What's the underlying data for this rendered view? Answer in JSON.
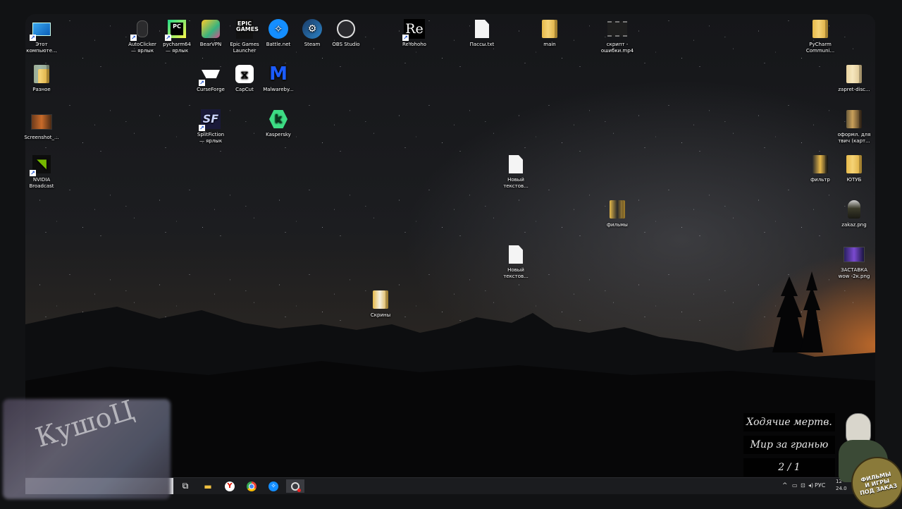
{
  "desktop_icons": [
    {
      "label": "Этот\nкомпьюте...",
      "icon": "monitor-icon"
    },
    {
      "label": "AutoClicker\n— ярлык",
      "icon": "mouse-icon"
    },
    {
      "label": "pycharm64\n— ярлык",
      "icon": "pycharm-icon"
    },
    {
      "label": "BearVPN",
      "icon": "bear-icon"
    },
    {
      "label": "Epic Games\nLauncher",
      "icon": "epic-games-icon",
      "glyph": "EPIC\nGAMES"
    },
    {
      "label": "Battle.net",
      "icon": "battlenet-icon"
    },
    {
      "label": "Steam",
      "icon": "steam-icon"
    },
    {
      "label": "OBS Studio",
      "icon": "obs-icon"
    },
    {
      "label": "ReYohoho",
      "icon": "reyohoho-icon",
      "glyph": "Re"
    },
    {
      "label": "Пассы.txt",
      "icon": "text-file-icon"
    },
    {
      "label": "main",
      "icon": "folder-icon"
    },
    {
      "label": "скрипт -\nошибки.mp4",
      "icon": "video-file-icon"
    },
    {
      "label": "PyCharm\nCommuni...",
      "icon": "folder-icon"
    },
    {
      "label": "Разное",
      "icon": "folder-icon"
    },
    {
      "label": "CurseForge",
      "icon": "curseforge-icon"
    },
    {
      "label": "CapCut",
      "icon": "capcut-icon"
    },
    {
      "label": "Malwareby...",
      "icon": "malwarebytes-icon",
      "glyph": "M"
    },
    {
      "label": "zapret-disc...",
      "icon": "folder-icon"
    },
    {
      "label": "Screenshot_...",
      "icon": "image-file-icon"
    },
    {
      "label": "SplitFiction\n— ярлык",
      "icon": "splitfiction-icon",
      "glyph": "SF"
    },
    {
      "label": "Kaspersky",
      "icon": "kaspersky-icon",
      "glyph": "k"
    },
    {
      "label": "оформл. для\nтвич (карт...",
      "icon": "folder-icon"
    },
    {
      "label": "NVIDIA\nBroadcast",
      "icon": "nvidia-icon"
    },
    {
      "label": "Новый\nтекстов...",
      "icon": "text-file-icon"
    },
    {
      "label": "фильтр",
      "icon": "folder-icon"
    },
    {
      "label": "ЮТУБ",
      "icon": "folder-icon"
    },
    {
      "label": "фильмы",
      "icon": "folder-icon"
    },
    {
      "label": "zakaz.png",
      "icon": "image-file-icon"
    },
    {
      "label": "Новый\nтекстов...",
      "icon": "text-file-icon"
    },
    {
      "label": "ЗАСТАВКА\nwow -2к.png",
      "icon": "image-file-icon"
    },
    {
      "label": "Скрины",
      "icon": "folder-icon"
    }
  ],
  "taskbar": {
    "pinned": [
      "task-view-icon",
      "file-explorer-icon",
      "yandex-browser-icon",
      "chrome-icon",
      "battlenet-icon",
      "obs-icon"
    ],
    "tray": {
      "chevron": "^",
      "language": "РУС",
      "clock_time": "12",
      "clock_date": "24.0"
    }
  },
  "overlay": {
    "streamer_name": "КушоЦ",
    "poll_option_1": "Ходячие мертв.",
    "poll_option_2": "Мир за гранью",
    "poll_counter": "2 / 1",
    "badge_text": "ФИЛЬМЫ\nИ ИГРЫ\nПОД ЗАКАЗ"
  }
}
